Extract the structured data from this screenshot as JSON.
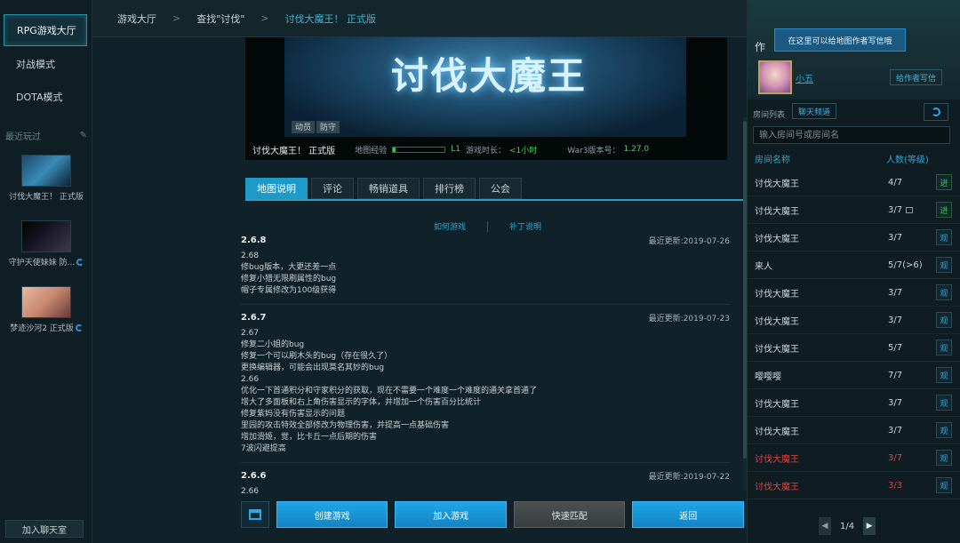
{
  "nav": {
    "items": [
      {
        "label": "RPG游戏大厅",
        "active": true
      },
      {
        "label": "对战模式",
        "active": false
      },
      {
        "label": "DOTA模式",
        "active": false
      }
    ],
    "recent_label": "最近玩过",
    "recent": [
      {
        "label": "讨伐大魔王！ 正式版",
        "sync": false
      },
      {
        "label": "守护天使妹妹 防...",
        "sync": true
      },
      {
        "label": "梦迹沙河2 正式版",
        "sync": true
      }
    ],
    "chat_button": "加入聊天室"
  },
  "breadcrumb": {
    "items": [
      "游戏大厅",
      "查找\"讨伐\"",
      "讨伐大魔王！ 正式版"
    ],
    "sep": ">"
  },
  "banner": {
    "title_art": "讨伐大魔王",
    "tags": [
      "动员",
      "防守"
    ],
    "game_name": "讨伐大魔王！ 正式版",
    "xp_label": "地图经验",
    "xp_fraction": 0.05,
    "level": "L1",
    "playtime_label": "游戏时长：",
    "playtime_value": "<1小时",
    "war3_label": "War3版本号：",
    "war3_value": "1.27.0"
  },
  "tabs": [
    "地图说明",
    "评论",
    "畅销道具",
    "排行榜",
    "公会"
  ],
  "sublinks": {
    "how_to_play": "如何游戏",
    "patch_notes": "补丁说明"
  },
  "changelog": [
    {
      "version": "2.6.8",
      "updated": "最近更新:2019-07-26",
      "lines": [
        "2.68",
        "修bug版本，大更还差一点",
        "修复小猎无限刷属性的bug",
        "帽子专属修改为100级获得"
      ]
    },
    {
      "version": "2.6.7",
      "updated": "最近更新:2019-07-23",
      "lines": [
        "2.67",
        "修复二小姐的bug",
        "修复一个可以刷木头的bug（存在很久了）",
        "更换编辑器，可能会出现莫名其妙的bug",
        "2.66",
        "优化一下首通积分和守家积分的获取，现在不需要一个难度一个难度的通关拿首通了",
        "增大了多面板和右上角伤害显示的字体，并增加一个伤害百分比统计",
        "修复紫妈没有伤害显示的问题",
        "里园的攻击特效全部修改为物理伤害，并提高一点基础伤害",
        "增加滑姬，觉，比卡丘一点后期的伤害",
        "7波闪避提高"
      ]
    },
    {
      "version": "2.6.6",
      "updated": "最近更新:2019-07-22",
      "lines": [
        "2.66"
      ]
    }
  ],
  "actions": {
    "create": "创建游戏",
    "join": "加入游戏",
    "match": "快速匹配",
    "back": "返回"
  },
  "right": {
    "header": "作",
    "tooltip": "在这里可以给地图作者写信哦",
    "author": "小五",
    "write_letter": "给作者写信",
    "room_list_label": "房间列表",
    "chat_channel": "聊天频道",
    "search_placeholder": "输入房间号或房间名",
    "col_name": "房间名称",
    "col_count": "人数(等级)",
    "rooms": [
      {
        "name": "讨伐大魔王",
        "count": "4/7",
        "action": "进",
        "type": "go",
        "red": false,
        "lock": false
      },
      {
        "name": "讨伐大魔王",
        "count": "3/7",
        "action": "进",
        "type": "go",
        "red": false,
        "lock": true
      },
      {
        "name": "讨伐大魔王",
        "count": "3/7",
        "action": "观",
        "type": "watch",
        "red": false,
        "lock": false
      },
      {
        "name": "来人",
        "count": "5/7(>6)",
        "action": "观",
        "type": "watch",
        "red": false,
        "lock": false
      },
      {
        "name": "讨伐大魔王",
        "count": "3/7",
        "action": "观",
        "type": "watch",
        "red": false,
        "lock": false
      },
      {
        "name": "讨伐大魔王",
        "count": "3/7",
        "action": "观",
        "type": "watch",
        "red": false,
        "lock": false
      },
      {
        "name": "讨伐大魔王",
        "count": "5/7",
        "action": "观",
        "type": "watch",
        "red": false,
        "lock": false
      },
      {
        "name": "嘤嘤嘤",
        "count": "7/7",
        "action": "观",
        "type": "watch",
        "red": false,
        "lock": false
      },
      {
        "name": "讨伐大魔王",
        "count": "3/7",
        "action": "观",
        "type": "watch",
        "red": false,
        "lock": false
      },
      {
        "name": "讨伐大魔王",
        "count": "3/7",
        "action": "观",
        "type": "watch",
        "red": false,
        "lock": false
      },
      {
        "name": "讨伐大魔王",
        "count": "3/7",
        "action": "观",
        "type": "watch",
        "red": true,
        "lock": false
      },
      {
        "name": "讨伐大魔王",
        "count": "3/3",
        "action": "观",
        "type": "watch",
        "red": true,
        "lock": false
      }
    ],
    "pager": "1/4"
  }
}
